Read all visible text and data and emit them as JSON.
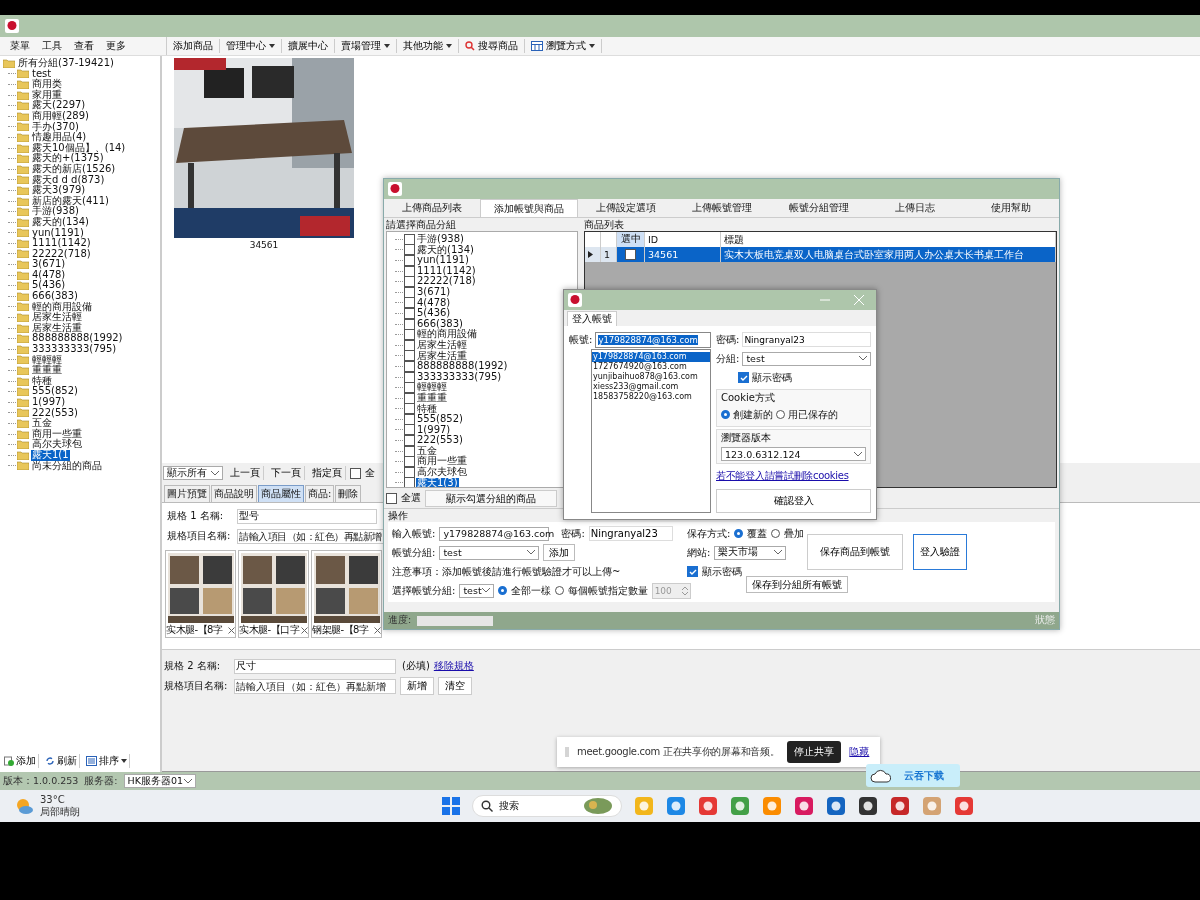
{
  "app": {
    "menu": [
      "菜單",
      "工具",
      "查看",
      "更多"
    ],
    "toolbar": [
      {
        "label": "添加商品",
        "kind": "plain"
      },
      {
        "label": "管理中心",
        "kind": "dropdown"
      },
      {
        "label": "擴展中心",
        "kind": "plain"
      },
      {
        "label": "賣場管理",
        "kind": "dropdown"
      },
      {
        "label": "其他功能",
        "kind": "dropdown"
      },
      {
        "label": "搜尋商品",
        "kind": "search"
      },
      {
        "label": "瀏覽方式",
        "kind": "view"
      }
    ],
    "tree": {
      "root": "所有分組(37-19421)",
      "children": [
        {
          "label": "test",
          "selected": false
        },
        {
          "label": "商用类",
          "selected": false
        },
        {
          "label": "家用重",
          "selected": false
        },
        {
          "label": "露天(2297)",
          "selected": false
        },
        {
          "label": "商用輕(289)",
          "selected": false
        },
        {
          "label": "手办(370)",
          "selected": false
        },
        {
          "label": "情趣用品(4)",
          "selected": false
        },
        {
          "label": "露天10個品】、(14)",
          "selected": false
        },
        {
          "label": "露天的+(1375)",
          "selected": false
        },
        {
          "label": "露天的新店(1526)",
          "selected": false
        },
        {
          "label": "露天d d d(873)",
          "selected": false
        },
        {
          "label": "露天3(979)",
          "selected": false
        },
        {
          "label": "新店的露天(411)",
          "selected": false
        },
        {
          "label": "手游(938)",
          "selected": false
        },
        {
          "label": "露天的(134)",
          "selected": false
        },
        {
          "label": "yun(1191)",
          "selected": false
        },
        {
          "label": "1111(1142)",
          "selected": false
        },
        {
          "label": "22222(718)",
          "selected": false
        },
        {
          "label": "3(671)",
          "selected": false
        },
        {
          "label": "4(478)",
          "selected": false
        },
        {
          "label": "5(436)",
          "selected": false
        },
        {
          "label": "666(383)",
          "selected": false
        },
        {
          "label": "輕的商用設備",
          "selected": false
        },
        {
          "label": "居家生活輕",
          "selected": false
        },
        {
          "label": "居家生活重",
          "selected": false
        },
        {
          "label": "888888888(1992)",
          "selected": false
        },
        {
          "label": "333333333(795)",
          "selected": false
        },
        {
          "label": "輕輕輕",
          "selected": false
        },
        {
          "label": "重重重",
          "selected": false
        },
        {
          "label": "特種",
          "selected": false
        },
        {
          "label": "555(852)",
          "selected": false
        },
        {
          "label": "1(997)",
          "selected": false
        },
        {
          "label": "222(553)",
          "selected": false
        },
        {
          "label": "五金",
          "selected": false
        },
        {
          "label": "商用一些重",
          "selected": false
        },
        {
          "label": "高尔夫球包",
          "selected": false
        },
        {
          "label": "露天1(1",
          "selected": true
        },
        {
          "label": "尚未分組的商品",
          "selected": false
        }
      ]
    },
    "tree_actions": [
      {
        "label": "添加",
        "kind": "add"
      },
      {
        "label": "刷新",
        "kind": "refresh"
      },
      {
        "label": "排序",
        "kind": "sort"
      }
    ],
    "products": [
      {
        "id": "34561",
        "kind": "picture"
      }
    ],
    "pager": {
      "filter": "顯示所有",
      "buttons": [
        "上一頁",
        "下一頁",
        "指定頁"
      ],
      "select_all": {
        "label": "全",
        "checked": false
      }
    },
    "tabs": [
      {
        "label": "圖片預覽",
        "selected": false
      },
      {
        "label": "商品說明",
        "selected": false
      },
      {
        "label": "商品屬性",
        "selected": true
      },
      {
        "label": "商品:",
        "selected": false
      },
      {
        "label": "刪除",
        "selected": false
      }
    ],
    "spec1": {
      "label": "規格 1 名稱:",
      "value": "型号",
      "item_label": "規格項目名稱:",
      "item_placeholder": "請輸入項目（如：紅色）再點新增",
      "thumbs": [
        "实木腿-【8字",
        "实木腿-【口字",
        "钢架腿-【8字"
      ]
    },
    "spec2": {
      "label": "規格 2 名稱:",
      "value": "尺寸",
      "required": "(必填)",
      "remove": "移除規格",
      "item_label": "規格項目名稱:",
      "item_placeholder": "請輸入項目（如：紅色）再點新增",
      "buttons": [
        "新增",
        "清空"
      ]
    },
    "status": {
      "version": "版本：1.0.0.253",
      "server_label": "服务器:",
      "server": "HK服务器01"
    }
  },
  "upload": {
    "tabs": [
      {
        "label": "上傳商品列表",
        "selected": false
      },
      {
        "label": "添加帳號與商品",
        "selected": true
      },
      {
        "label": "上傳設定選項",
        "selected": false
      },
      {
        "label": "上傳帳號管理",
        "selected": false
      },
      {
        "label": "帳號分組管理",
        "selected": false
      },
      {
        "label": "上傳日志",
        "selected": false
      },
      {
        "label": "使用幫助",
        "selected": false
      }
    ],
    "group_title": "請選擇商品分組",
    "groups": [
      {
        "label": "手游(938)",
        "checked": false,
        "selected": false
      },
      {
        "label": "露天的(134)",
        "checked": false,
        "selected": false
      },
      {
        "label": "yun(1191)",
        "checked": false,
        "selected": false
      },
      {
        "label": "1111(1142)",
        "checked": false,
        "selected": false
      },
      {
        "label": "22222(718)",
        "checked": false,
        "selected": false
      },
      {
        "label": "3(671)",
        "checked": false,
        "selected": false
      },
      {
        "label": "4(478)",
        "checked": false,
        "selected": false
      },
      {
        "label": "5(436)",
        "checked": false,
        "selected": false
      },
      {
        "label": "666(383)",
        "checked": false,
        "selected": false
      },
      {
        "label": "輕的商用設備",
        "checked": false,
        "selected": false
      },
      {
        "label": "居家生活輕",
        "checked": false,
        "selected": false
      },
      {
        "label": "居家生活重",
        "checked": false,
        "selected": false
      },
      {
        "label": "888888888(1992)",
        "checked": false,
        "selected": false
      },
      {
        "label": "333333333(795)",
        "checked": false,
        "selected": false
      },
      {
        "label": "輕輕輕",
        "checked": false,
        "selected": false
      },
      {
        "label": "重重重",
        "checked": false,
        "selected": false
      },
      {
        "label": "特種",
        "checked": false,
        "selected": false
      },
      {
        "label": "555(852)",
        "checked": false,
        "selected": false
      },
      {
        "label": "1(997)",
        "checked": false,
        "selected": false
      },
      {
        "label": "222(553)",
        "checked": false,
        "selected": false
      },
      {
        "label": "五金",
        "checked": false,
        "selected": false
      },
      {
        "label": "商用一些重",
        "checked": false,
        "selected": false
      },
      {
        "label": "高尔夫球包",
        "checked": false,
        "selected": false
      },
      {
        "label": "露天1(3)",
        "checked": false,
        "selected": true
      }
    ],
    "select_all": {
      "label": "全選",
      "checked": false
    },
    "show_button": "顯示勾選分組的商品",
    "list_title": "商品列表",
    "columns": [
      "選中",
      "ID",
      "標題"
    ],
    "rows": [
      {
        "index": "1",
        "checked": false,
        "id": "34561",
        "title": "实木大板电竞桌双人电脑桌台式卧室家用两人办公桌大长书桌工作台",
        "selected": true
      }
    ],
    "ops": {
      "title": "操作",
      "account_label": "輸入帳號:",
      "account": "y179828874@163.com",
      "password_label": "密碼:",
      "password": "Ningranyal23",
      "save_mode_label": "保存方式:",
      "save_modes": [
        {
          "label": "覆蓋",
          "selected": true
        },
        {
          "label": "疊加",
          "selected": false
        }
      ],
      "save_button": "保存商品到帳號",
      "login_button": "登入驗證",
      "group_label": "帳號分組:",
      "group": "test",
      "add_button": "添加",
      "site_label": "網站:",
      "site": "樂天市場",
      "note": "注意事項：添加帳號後請進行帳號驗證才可以上傳~",
      "show_password": {
        "label": "顯示密碼",
        "checked": true
      },
      "choose_group_label": "選擇帳號分組:",
      "choose_group": "test",
      "dist": [
        {
          "label": "全部一樣",
          "selected": true
        },
        {
          "label": "每個帳號指定數量",
          "selected": false
        }
      ],
      "count": "100",
      "save_all": "保存到分組所有帳號"
    },
    "progress_label": "進度:",
    "progress": {
      "level": 0
    },
    "state_label": "狀態"
  },
  "login": {
    "tab": "登入帳號",
    "account_label": "帳號:",
    "account": "y179828874@163.com",
    "accounts": [
      {
        "label": "y179828874@163.com",
        "selected": true
      },
      {
        "label": "1727674920@163.com",
        "selected": false
      },
      {
        "label": "yunjibaihuo878@163.com",
        "selected": false
      },
      {
        "label": "xiess233@gmail.com",
        "selected": false
      },
      {
        "label": "18583758220@163.com",
        "selected": false
      }
    ],
    "password_label": "密碼:",
    "password": "Ningranyal23",
    "group_label": "分組:",
    "group": "test",
    "show_password": {
      "label": "顯示密碼",
      "checked": true
    },
    "cookie_title": "Cookie方式",
    "cookie_modes": [
      {
        "label": "創建新的",
        "selected": true
      },
      {
        "label": "用已保存的",
        "selected": false
      }
    ],
    "browser_title": "瀏覽器版本",
    "browser": "123.0.6312.124",
    "link": "若不能登入請嘗試刪除cookies",
    "confirm": "確認登入"
  },
  "share_bar": {
    "text": "meet.google.com 正在共享你的屏幕和音频。",
    "stop": "停止共享",
    "hide": "隐藏"
  },
  "cloud_button": "云吞下载",
  "taskbar": {
    "temp": "33°C",
    "weather": "局部晴朗",
    "search": "搜索"
  }
}
